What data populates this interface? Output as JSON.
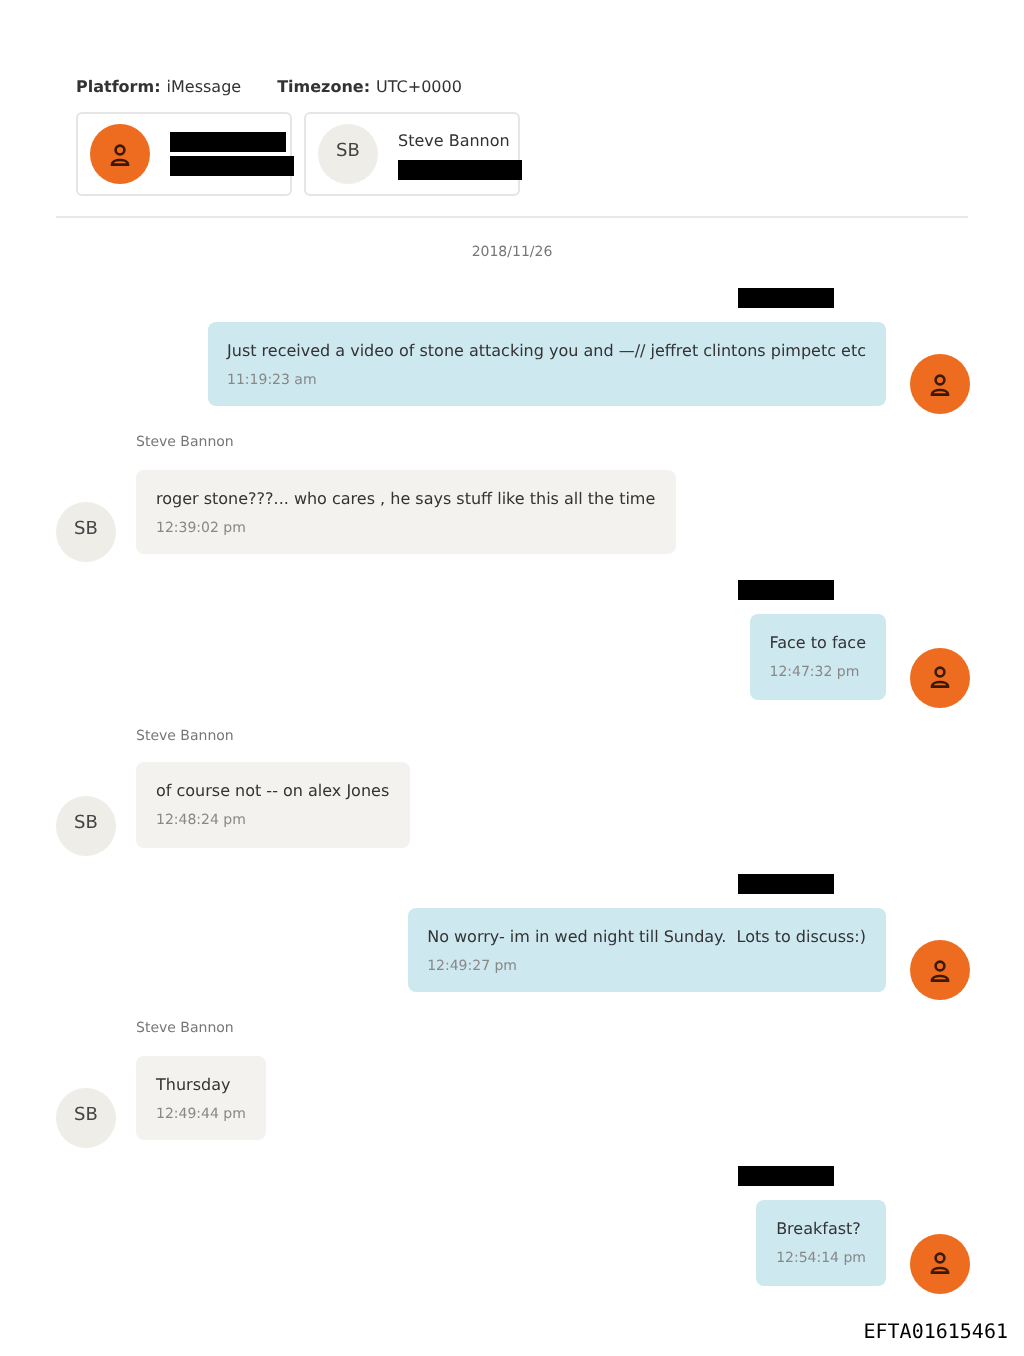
{
  "header": {
    "platform_label": "Platform:",
    "platform": "iMessage",
    "timezone_label": "Timezone:",
    "timezone": "UTC+0000"
  },
  "participants": [
    {
      "kind": "icon"
    },
    {
      "kind": "initials",
      "initials": "SB",
      "name": "Steve Bannon"
    }
  ],
  "date": "2018/11/26",
  "messages": [
    {
      "kind": "outgoing",
      "text": "Just received a video of stone attacking you and —// jeffret clintons pimpetc etc",
      "time": "11:19:23 am"
    },
    {
      "kind": "incoming",
      "sender": "Steve Bannon",
      "initials": "SB",
      "text": "roger stone???... who cares , he says stuff like this all the time",
      "time": "12:39:02 pm"
    },
    {
      "kind": "outgoing",
      "text": "Face to face",
      "time": "12:47:32 pm"
    },
    {
      "kind": "incoming",
      "sender": "Steve Bannon",
      "initials": "SB",
      "text": "of course not -- on alex Jones",
      "time": "12:48:24 pm"
    },
    {
      "kind": "outgoing",
      "text": "No worry- im in wed night till Sunday.  Lots to discuss:)",
      "time": "12:49:27 pm"
    },
    {
      "kind": "incoming",
      "sender": "Steve Bannon",
      "initials": "SB",
      "text": "Thursday",
      "time": "12:49:44 pm"
    },
    {
      "kind": "outgoing",
      "text": "Breakfast?",
      "time": "12:54:14 pm"
    }
  ],
  "stamp": "EFTA01615461"
}
